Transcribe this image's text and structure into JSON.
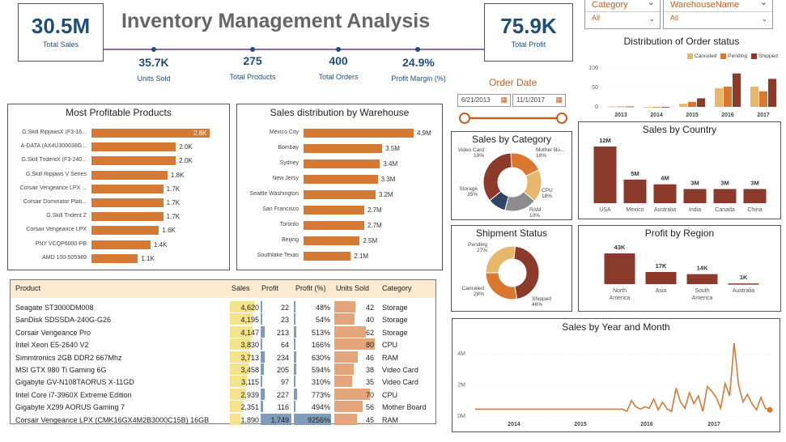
{
  "title": "Inventory Management Analysis",
  "kpis": {
    "total_sales": {
      "value": "30.5M",
      "label": "Total Sales"
    },
    "total_profit": {
      "value": "75.9K",
      "label": "Total Profit"
    },
    "units_sold": {
      "value": "35.7K",
      "label": "Units Sold"
    },
    "total_products": {
      "value": "275",
      "label": "Total Products"
    },
    "total_orders": {
      "value": "400",
      "label": "Total Orders"
    },
    "profit_margin": {
      "value": "24.9%",
      "label": "Profit Margin (%)"
    }
  },
  "filters": {
    "category": {
      "label": "Category",
      "value": "All"
    },
    "warehouse": {
      "label": "WarehouseName",
      "value": "All"
    },
    "order_date": {
      "label": "Order Date",
      "start": "6/21/2013",
      "end": "11/1/2017"
    }
  },
  "colors": {
    "canceled": "#e7b86b",
    "pending": "#d9782e",
    "shipped": "#8b3a2b",
    "bar": "#d47a35",
    "navy": "#1f4e79"
  },
  "chart_data": [
    {
      "id": "most_profitable",
      "type": "bar",
      "title": "Most Profitable Products",
      "categories": [
        "G.Skill RipjawsX (F3-16...",
        "A-DATA (AX4U300038G...",
        "G.Skill TridentX (F3-240...",
        "G.Skill Ripjaws V Series",
        "Corsair Vengeance LPX ...",
        "Corsair Dominator Plati...",
        "G.Skill Trident Z",
        "Corsair Vengeance LPX",
        "PNY VCQP6000-PB",
        "AMD 100-505989"
      ],
      "values": [
        2.8,
        2.0,
        2.0,
        1.8,
        1.7,
        1.7,
        1.7,
        1.6,
        1.4,
        1.1
      ],
      "labels": [
        "2.8K",
        "2.0K",
        "2.0K",
        "1.8K",
        "1.7K",
        "1.7K",
        "1.7K",
        "1.6K",
        "1.4K",
        "1.1K"
      ]
    },
    {
      "id": "sales_warehouse",
      "type": "bar",
      "title": "Sales distribution by Warehouse",
      "categories": [
        "Mexico City",
        "Bombay",
        "Sydney",
        "New Jersy",
        "Seattle Washington",
        "San Francisco",
        "Toronto",
        "Beijing",
        "Southlake Texas"
      ],
      "values": [
        4.9,
        3.5,
        3.4,
        3.3,
        3.2,
        2.7,
        2.7,
        2.5,
        2.1
      ],
      "labels": [
        "4.9M",
        "3.5M",
        "3.4M",
        "3.3M",
        "3.2M",
        "2.7M",
        "2.7M",
        "2.5M",
        "2.1M"
      ]
    },
    {
      "id": "order_status",
      "type": "bar",
      "title": "Distribution of Order status",
      "categories": [
        "2013",
        "2014",
        "2015",
        "2016",
        "2017"
      ],
      "series": [
        {
          "name": "Canceled",
          "values": [
            1,
            0,
            8,
            48,
            52
          ]
        },
        {
          "name": "Pending",
          "values": [
            1,
            0,
            13,
            52,
            40
          ]
        },
        {
          "name": "Shipped",
          "values": [
            1,
            0,
            22,
            86,
            72
          ]
        }
      ],
      "yticks": [
        "0",
        "50",
        "100"
      ],
      "ylim": [
        0,
        100
      ]
    },
    {
      "id": "sales_category",
      "type": "pie",
      "title": "Sales by Category",
      "slices": [
        {
          "name": "Video Card",
          "pct": "19%",
          "value": 19
        },
        {
          "name": "Mother Bo...",
          "pct": "18%",
          "value": 18
        },
        {
          "name": "CPU",
          "pct": "18%",
          "value": 18
        },
        {
          "name": "RAM",
          "pct": "10%",
          "value": 10
        },
        {
          "name": "Storage",
          "pct": "35%",
          "value": 35
        }
      ]
    },
    {
      "id": "shipment_status",
      "type": "pie",
      "title": "Shipment Status",
      "slices": [
        {
          "name": "Pending",
          "pct": "27%",
          "value": 27
        },
        {
          "name": "Shipped",
          "pct": "46%",
          "value": 46
        },
        {
          "name": "Canceled",
          "pct": "28%",
          "value": 28
        }
      ]
    },
    {
      "id": "sales_country",
      "type": "bar",
      "title": "Sales by Country",
      "categories": [
        "USA",
        "Mexico",
        "Australia",
        "India",
        "Canada",
        "China"
      ],
      "values": [
        12,
        5,
        4,
        3,
        3,
        3
      ],
      "labels": [
        "12M",
        "5M",
        "4M",
        "3M",
        "3M",
        "3M"
      ]
    },
    {
      "id": "profit_region",
      "type": "bar",
      "title": "Profit by Region",
      "categories": [
        "North America",
        "Asia",
        "South America",
        "Australia"
      ],
      "values": [
        43,
        17,
        14,
        1
      ],
      "labels": [
        "43K",
        "17K",
        "14K",
        "1K"
      ]
    },
    {
      "id": "sales_year_month",
      "type": "line",
      "title": "Sales by Year and Month",
      "x_ticks": [
        "2014",
        "2015",
        "2016",
        "2017"
      ],
      "y_ticks": [
        "0M",
        "2M",
        "4M"
      ],
      "ylim": [
        0,
        5
      ],
      "values": [
        0.45,
        0.45,
        0.45,
        0.45,
        0.45,
        0.45,
        0.45,
        0.45,
        0.45,
        0.45,
        0.45,
        0.45,
        0.45,
        0.45,
        0.45,
        0.45,
        0.45,
        0.45,
        0.45,
        0.45,
        0.45,
        0.45,
        0.45,
        0.45,
        0.45,
        0.45,
        0.45,
        0.45,
        0.45,
        0.45,
        0.45,
        0.45,
        0.45,
        0.45,
        0.3,
        1.0,
        0.6,
        0.45,
        0.6,
        0.5,
        1.1,
        0.4,
        0.9,
        0.45,
        0.3,
        1.8,
        0.9,
        0.5,
        1.5,
        0.8,
        1.3,
        0.3,
        1.9,
        1.6,
        1.2,
        0.5,
        2.1,
        1.3,
        4.7,
        2.0,
        0.9,
        1.4,
        0.8,
        0.4,
        1.2,
        0.5,
        0.4
      ]
    }
  ],
  "table": {
    "columns": [
      "Product",
      "Sales",
      "Profit",
      "Profit (%)",
      "Units Sold",
      "Category"
    ],
    "rows": [
      [
        "Seagate ST3000DM008",
        "4,620",
        "22",
        "48%",
        "42",
        "Storage"
      ],
      [
        "SanDisk SDSSDA-240G-G26",
        "4,195",
        "23",
        "54%",
        "40",
        "Storage"
      ],
      [
        "Corsair Vengeance Pro",
        "4,147",
        "213",
        "513%",
        "62",
        "Storage"
      ],
      [
        "Intel Xeon E5-2640 V2",
        "3,830",
        "64",
        "166%",
        "80",
        "CPU"
      ],
      [
        "Simmtronics 2GB DDR2 667Mhz",
        "3,713",
        "234",
        "630%",
        "46",
        "RAM"
      ],
      [
        "MSI GTX 980 Ti Gaming 6G",
        "3,458",
        "205",
        "594%",
        "38",
        "Video Card"
      ],
      [
        "Gigabyte GV-N108TAORUS X-11GD",
        "3,115",
        "97",
        "310%",
        "35",
        "Video Card"
      ],
      [
        "Intel Core i7-3960X Extreme Edition",
        "2,939",
        "227",
        "773%",
        "70",
        "CPU"
      ],
      [
        "Gigabyte X299 AORUS Gaming 7",
        "2,351",
        "116",
        "494%",
        "56",
        "Mother Board"
      ],
      [
        "Corsair Vengeance LPX (CMK16GX4M2B3000C15B) 16GB",
        "1,890",
        "1,749",
        "9256%",
        "45",
        "RAM"
      ]
    ],
    "sales_num": [
      4620,
      4195,
      4147,
      3830,
      3713,
      3458,
      3115,
      2939,
      2351,
      1890
    ],
    "profit_num": [
      22,
      23,
      213,
      64,
      234,
      205,
      97,
      227,
      116,
      1749
    ],
    "pct_num": [
      48,
      54,
      513,
      166,
      630,
      594,
      310,
      773,
      494,
      9256
    ],
    "units_num": [
      42,
      40,
      62,
      80,
      46,
      38,
      35,
      70,
      56,
      45
    ]
  }
}
